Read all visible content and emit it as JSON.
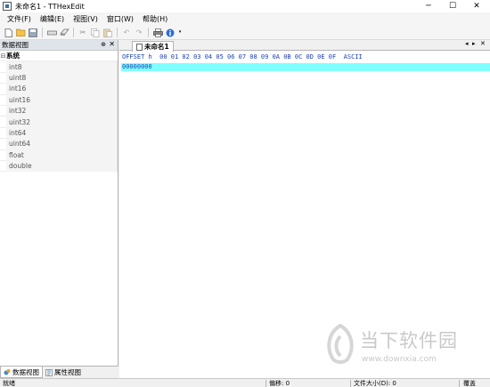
{
  "window": {
    "title": "未命名1 - TTHexEdit",
    "min_glyph": "─",
    "max_glyph": "☐",
    "close_glyph": "✕"
  },
  "menu": {
    "items": [
      {
        "label": "文件(F)"
      },
      {
        "label": "编辑(E)"
      },
      {
        "label": "视图(V)"
      },
      {
        "label": "窗口(W)"
      },
      {
        "label": "帮助(H)"
      }
    ]
  },
  "toolbar": {
    "icons": [
      "new-file-icon",
      "open-folder-icon",
      "save-icon",
      "tool-a-icon",
      "eraser-icon",
      "cut-icon",
      "copy-icon",
      "paste-icon",
      "undo-icon",
      "redo-icon",
      "print-icon",
      "info-icon"
    ]
  },
  "left_panel": {
    "title": "数据视图",
    "pin_glyph": "⊕",
    "close_glyph": "✕",
    "tree": {
      "root_label": "系统",
      "collapse_glyph": "⊟",
      "items": [
        "int8",
        "uint8",
        "int16",
        "uint16",
        "int32",
        "uint32",
        "int64",
        "uint64",
        "float",
        "double"
      ]
    },
    "bottom_tabs": [
      {
        "label": "数据视图",
        "active": true
      },
      {
        "label": "属性视图",
        "active": false
      }
    ]
  },
  "document": {
    "tab_label": "未命名1",
    "nav_left": "◂",
    "nav_right": "▸",
    "close_glyph": "✕",
    "hex_header": "OFFSET h  00 01 02 03 04 05 06 07 08 09 0A 0B 0C 0D 0E 0F  ASCII",
    "hex_first_row": "00000000",
    "header_color": "#1a3fb8",
    "row_highlight_color": "#80ffff"
  },
  "statusbar": {
    "ready": "就绪",
    "offset": "偏移: 0",
    "file_size": "文件大小(D): 0",
    "mode": "覆盖"
  },
  "watermark": {
    "title": "当下软件园",
    "url": "www.downxia.com"
  }
}
